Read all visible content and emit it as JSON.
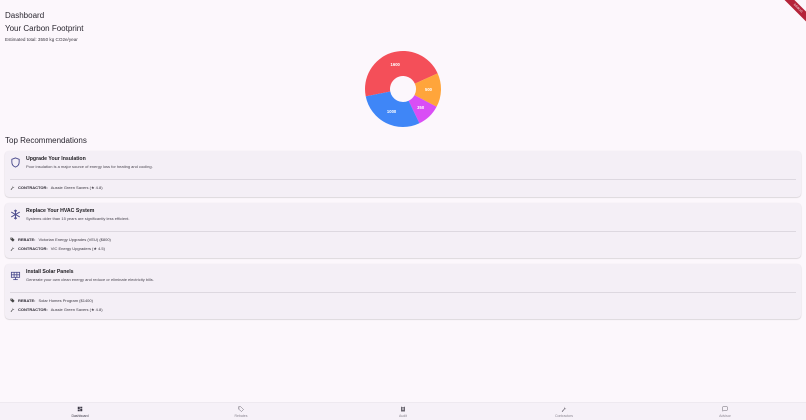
{
  "app": {
    "title": "Dashboard",
    "debug_banner": "DEBUG"
  },
  "footprint": {
    "heading": "Your Carbon Footprint",
    "estimate": "Estimated total: 3550 kg CO2e/year"
  },
  "chart_data": {
    "type": "pie",
    "variant": "donut",
    "values": [
      1600,
      500,
      350,
      1000
    ],
    "labels": [
      "1600",
      "500",
      "350",
      "1000"
    ],
    "colors": [
      "#f44f59",
      "#ffa53b",
      "#d94ef5",
      "#3f86f7"
    ],
    "label_color": "#ffffff"
  },
  "recommendations": {
    "heading": "Top Recommendations",
    "items": [
      {
        "title": "Upgrade Your Insulation",
        "description": "Poor insulation is a major source of energy loss for heating and cooling.",
        "icon": "shield-icon",
        "lines": [
          {
            "icon": "wrench-icon",
            "label": "CONTRACTOR:",
            "value": "Aussie Green Savers (★ 4.8)"
          }
        ]
      },
      {
        "title": "Replace Your HVAC System",
        "description": "Systems older than 15 years are significantly less efficient.",
        "icon": "snowflake-icon",
        "lines": [
          {
            "icon": "tag-icon",
            "label": "REBATE:",
            "value": "Victorian Energy Upgrades (VEU) ($800)"
          },
          {
            "icon": "wrench-icon",
            "label": "CONTRACTOR:",
            "value": "VIC Energy Upgraders (★ 4.5)"
          }
        ]
      },
      {
        "title": "Install Solar Panels",
        "description": "Generate your own clean energy and reduce or eliminate electricity bills.",
        "icon": "solar-panel-icon",
        "lines": [
          {
            "icon": "tag-icon",
            "label": "REBATE:",
            "value": "Solar Homes Program ($1400)"
          },
          {
            "icon": "wrench-icon",
            "label": "CONTRACTOR:",
            "value": "Aussie Green Savers (★ 4.8)"
          }
        ]
      }
    ]
  },
  "nav": {
    "items": [
      {
        "label": "Dashboard",
        "icon": "dashboard-icon",
        "active": true
      },
      {
        "label": "Rebates",
        "icon": "tag-icon",
        "active": false
      },
      {
        "label": "Audit",
        "icon": "clipboard-icon",
        "active": false
      },
      {
        "label": "Contractors",
        "icon": "wrench-icon",
        "active": false
      },
      {
        "label": "Advisor",
        "icon": "chat-icon",
        "active": false
      }
    ]
  }
}
